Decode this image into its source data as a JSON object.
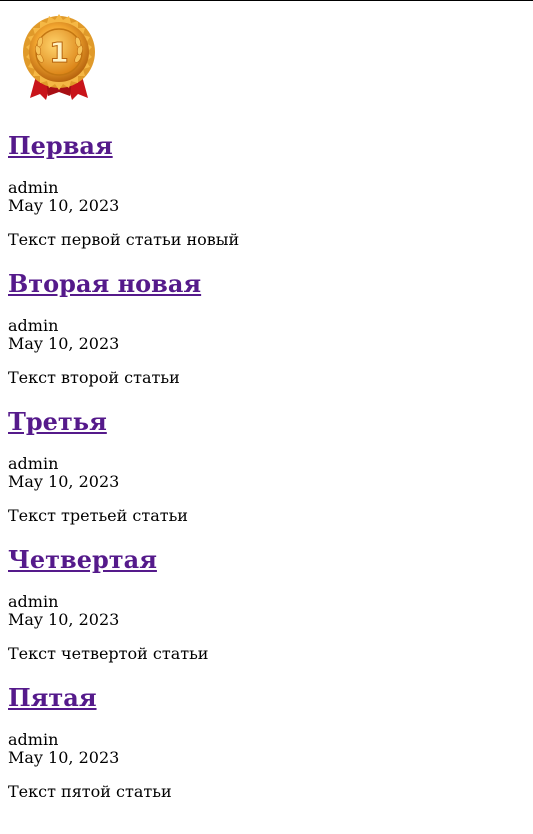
{
  "logo": {
    "icon": "gold-medal-first-place-icon",
    "digit": "1",
    "colors": {
      "gold": "#f2a630",
      "ribbon": "#c8141a"
    }
  },
  "link_color": "#551a8b",
  "articles": [
    {
      "title": "Первая",
      "author": "admin",
      "date": "May 10, 2023",
      "text": "Текст первой статьи новый"
    },
    {
      "title": "Вторая новая",
      "author": "admin",
      "date": "May 10, 2023",
      "text": "Текст второй статьи"
    },
    {
      "title": "Третья",
      "author": "admin",
      "date": "May 10, 2023",
      "text": "Текст третьей статьи"
    },
    {
      "title": "Четвертая",
      "author": "admin",
      "date": "May 10, 2023",
      "text": "Текст четвертой статьи"
    },
    {
      "title": "Пятая",
      "author": "admin",
      "date": "May 10, 2023",
      "text": "Текст пятой статьи"
    }
  ]
}
